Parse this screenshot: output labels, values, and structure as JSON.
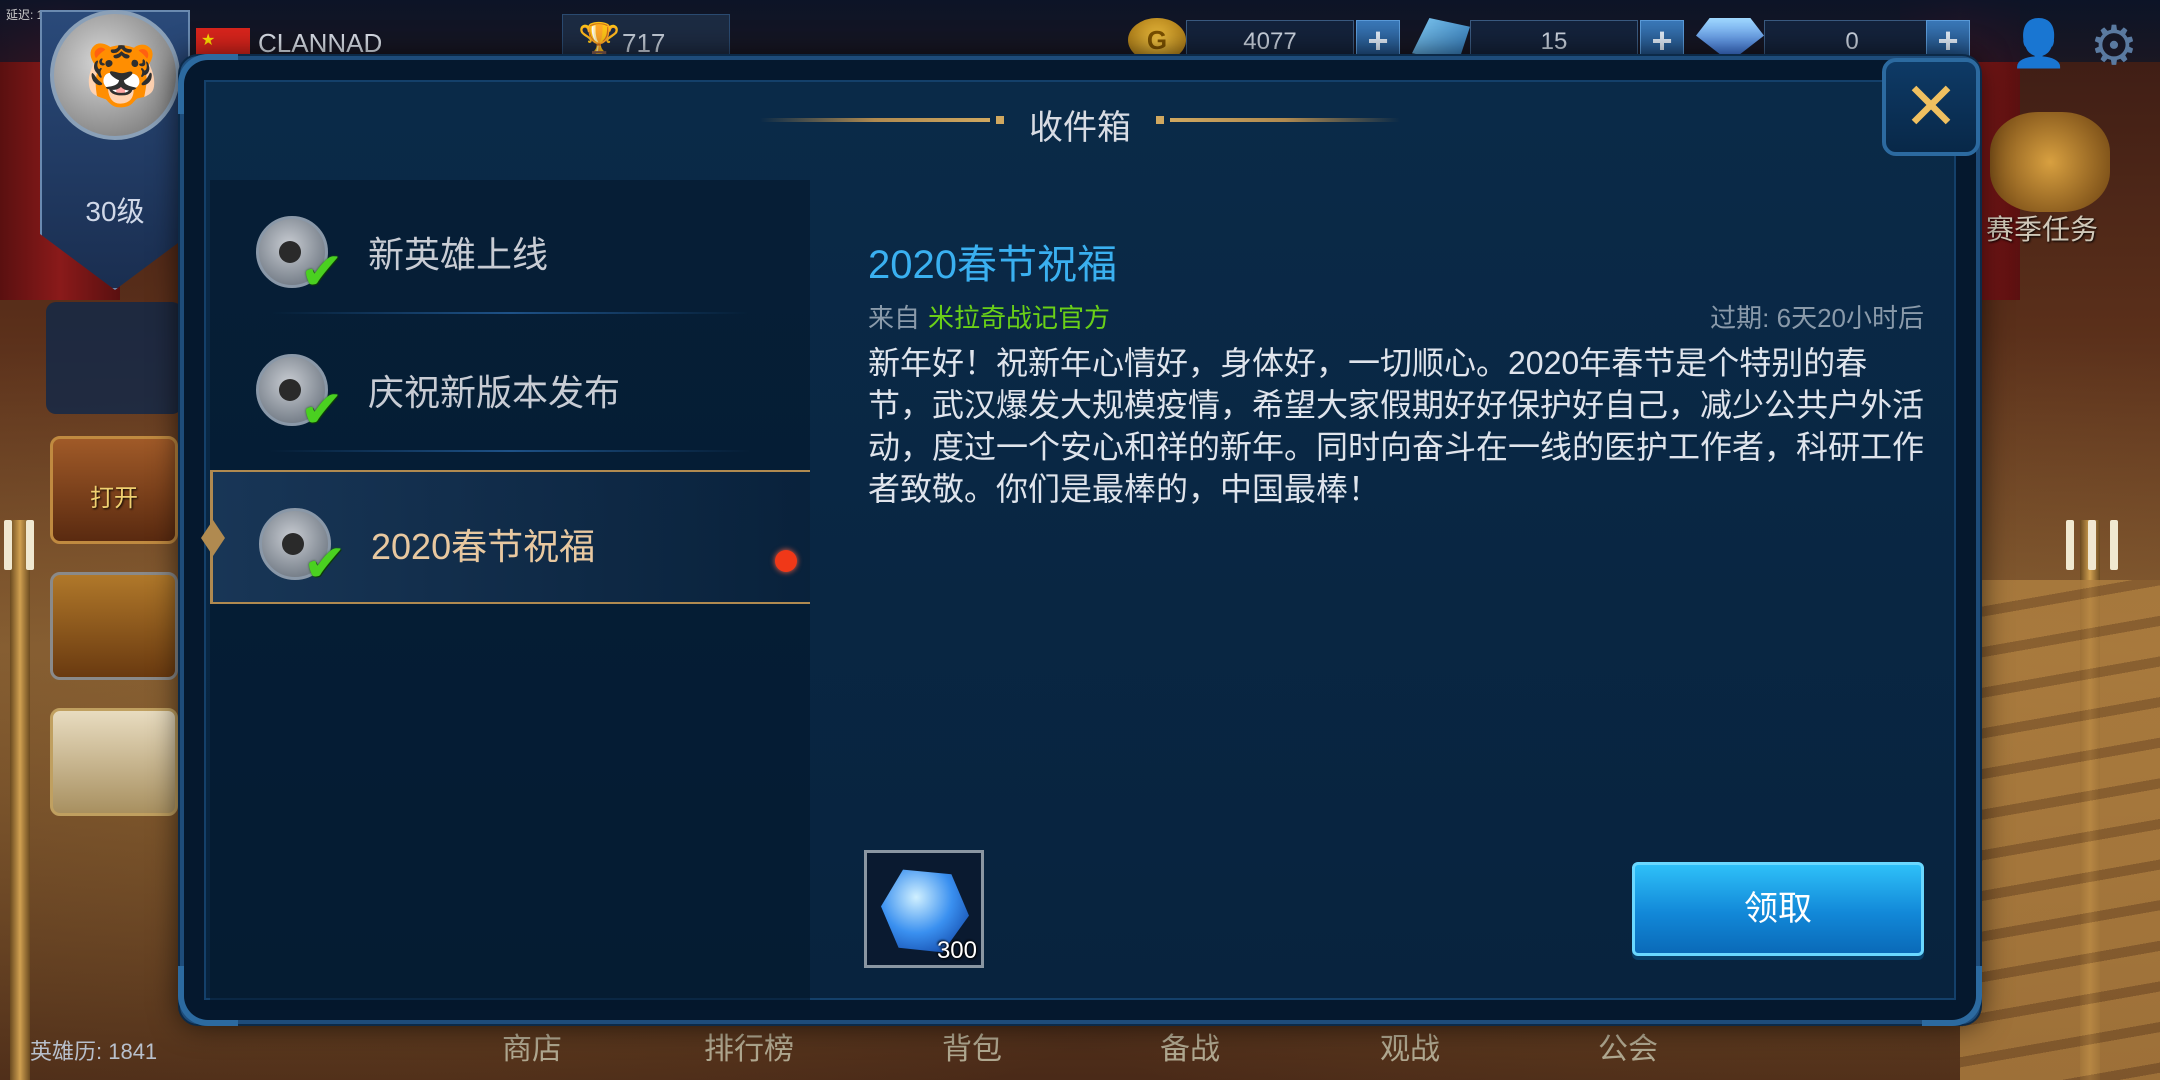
{
  "debug": {
    "fps_text": "延迟: 133"
  },
  "player": {
    "name": "CLANNAD",
    "level": "30级",
    "trophies": "717",
    "hero_history": "英雄历: 1841"
  },
  "resources": {
    "gold": "4077",
    "shards": "15",
    "gems": "0"
  },
  "side": {
    "chest_open_label": "打开",
    "season_task": "赛季任务"
  },
  "bottom_nav": [
    "商店",
    "排行榜",
    "背包",
    "备战",
    "观战",
    "公会"
  ],
  "modal": {
    "title": "收件箱",
    "close_symbol": "✕",
    "mails": [
      {
        "label": "新英雄上线"
      },
      {
        "label": "庆祝新版本发布"
      },
      {
        "label": "2020春节祝福",
        "selected": true,
        "unread": true
      }
    ],
    "detail": {
      "title": "2020春节祝福",
      "from_prefix": "来自",
      "from_name": "米拉奇战记官方",
      "expire": "过期: 6天20小时后",
      "body": "新年好！祝新年心情好，身体好，一切顺心。2020年春节是个特别的春节，武汉爆发大规模疫情，希望大家假期好好保护好自己，减少公共户外活动，度过一个安心和祥的新年。同时向奋斗在一线的医护工作者，科研工作者致敬。你们是最棒的，中国最棒！",
      "reward_count": "300",
      "claim_label": "领取"
    }
  },
  "colors": {
    "accent": "#3ab0f0",
    "sender": "#6ad018",
    "unread_dot": "#f03818",
    "gold_trim": "#b08a50"
  }
}
